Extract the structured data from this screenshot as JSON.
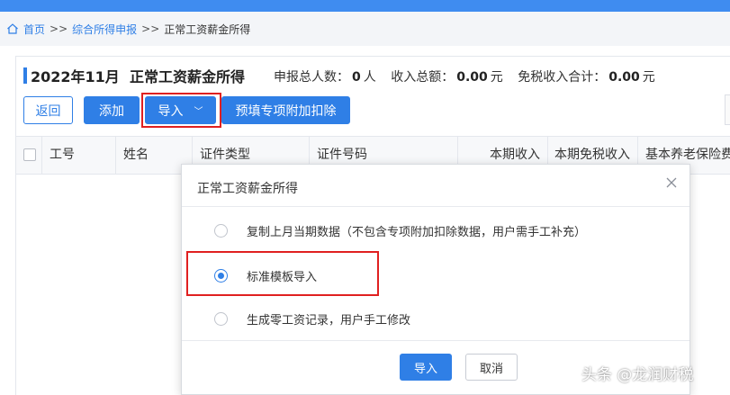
{
  "breadcrumb": {
    "home": "首页",
    "sep": ">>",
    "level1": "综合所得申报",
    "current": "正常工资薪金所得"
  },
  "page": {
    "title": "2022年11月  正常工资薪金所得",
    "stats": {
      "total_people_label": "申报总人数：",
      "total_people_value": "0",
      "total_people_unit": "人",
      "income_label": "收入总额：",
      "income_value": "0.00",
      "income_unit": "元",
      "exempt_label": "免税收入合计：",
      "exempt_value": "0.00",
      "exempt_unit": "元"
    }
  },
  "toolbar": {
    "back": "返回",
    "add": "添加",
    "import": "导入",
    "prefill": "预填专项附加扣除"
  },
  "table": {
    "columns": [
      "工号",
      "姓名",
      "证件类型",
      "证件号码",
      "本期收入",
      "本期免税收入",
      "基本养老保险费"
    ]
  },
  "dialog": {
    "title": "正常工资薪金所得",
    "options": [
      {
        "label": "复制上月当期数据（不包含专项附加扣除数据，用户需手工补充）",
        "selected": false
      },
      {
        "label": "标准模板导入",
        "selected": true
      },
      {
        "label": "生成零工资记录，用户手工修改",
        "selected": false
      }
    ],
    "confirm": "导入",
    "cancel": "取消"
  },
  "watermark": "头条 @龙润财税",
  "colors": {
    "primary": "#2f7fe6",
    "highlight": "#e02020"
  }
}
